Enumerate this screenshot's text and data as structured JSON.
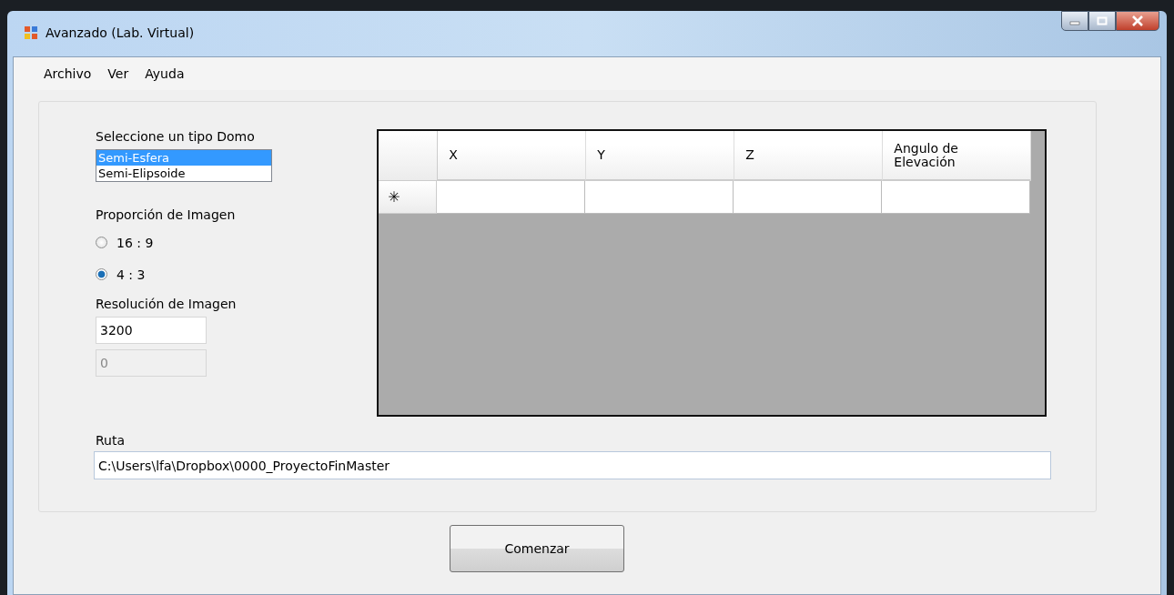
{
  "window": {
    "title": "Avanzado (Lab. Virtual)"
  },
  "menu": [
    "Archivo",
    "Ver",
    "Ayuda"
  ],
  "dome": {
    "label": "Seleccione un tipo Domo",
    "items": [
      {
        "label": "Semi-Esfera",
        "selected": true
      },
      {
        "label": "Semi-Elipsoide",
        "selected": false
      }
    ]
  },
  "ratio": {
    "label": "Proporción de Imagen",
    "options": [
      {
        "label": "16 : 9",
        "selected": false
      },
      {
        "label": "4 : 3",
        "selected": true
      }
    ]
  },
  "resolution": {
    "label": "Resolución de Imagen",
    "value": "3200",
    "second_value": "0",
    "second_disabled": true
  },
  "grid": {
    "columns": [
      "X",
      "Y",
      "Z",
      "Angulo de Elevación"
    ],
    "new_row_marker": "✳"
  },
  "path": {
    "label": "Ruta",
    "value": "C:\\Users\\lfa\\Dropbox\\0000_ProyectoFinMaster"
  },
  "start_button": "Comenzar"
}
